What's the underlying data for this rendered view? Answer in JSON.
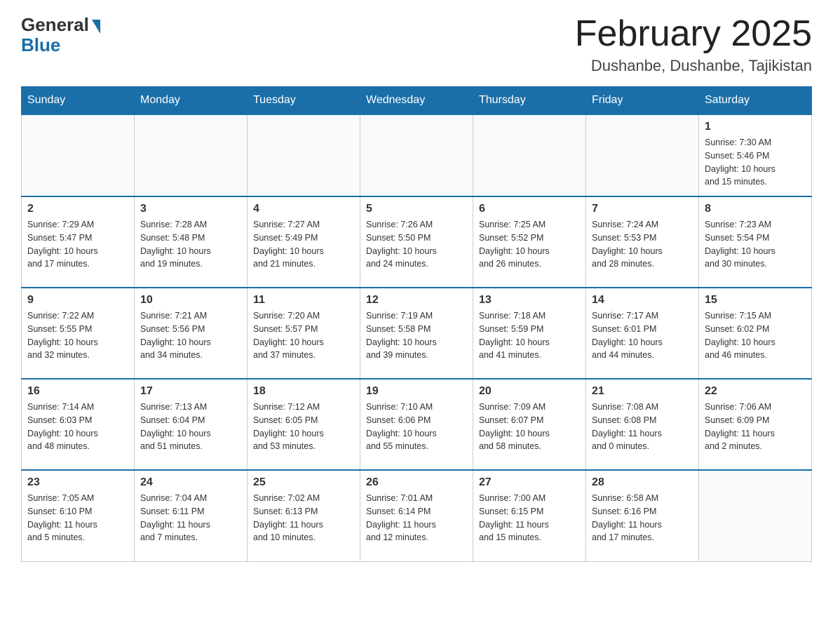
{
  "logo": {
    "general": "General",
    "blue": "Blue"
  },
  "title": "February 2025",
  "location": "Dushanbe, Dushanbe, Tajikistan",
  "days_of_week": [
    "Sunday",
    "Monday",
    "Tuesday",
    "Wednesday",
    "Thursday",
    "Friday",
    "Saturday"
  ],
  "weeks": [
    [
      {
        "day": "",
        "info": ""
      },
      {
        "day": "",
        "info": ""
      },
      {
        "day": "",
        "info": ""
      },
      {
        "day": "",
        "info": ""
      },
      {
        "day": "",
        "info": ""
      },
      {
        "day": "",
        "info": ""
      },
      {
        "day": "1",
        "info": "Sunrise: 7:30 AM\nSunset: 5:46 PM\nDaylight: 10 hours\nand 15 minutes."
      }
    ],
    [
      {
        "day": "2",
        "info": "Sunrise: 7:29 AM\nSunset: 5:47 PM\nDaylight: 10 hours\nand 17 minutes."
      },
      {
        "day": "3",
        "info": "Sunrise: 7:28 AM\nSunset: 5:48 PM\nDaylight: 10 hours\nand 19 minutes."
      },
      {
        "day": "4",
        "info": "Sunrise: 7:27 AM\nSunset: 5:49 PM\nDaylight: 10 hours\nand 21 minutes."
      },
      {
        "day": "5",
        "info": "Sunrise: 7:26 AM\nSunset: 5:50 PM\nDaylight: 10 hours\nand 24 minutes."
      },
      {
        "day": "6",
        "info": "Sunrise: 7:25 AM\nSunset: 5:52 PM\nDaylight: 10 hours\nand 26 minutes."
      },
      {
        "day": "7",
        "info": "Sunrise: 7:24 AM\nSunset: 5:53 PM\nDaylight: 10 hours\nand 28 minutes."
      },
      {
        "day": "8",
        "info": "Sunrise: 7:23 AM\nSunset: 5:54 PM\nDaylight: 10 hours\nand 30 minutes."
      }
    ],
    [
      {
        "day": "9",
        "info": "Sunrise: 7:22 AM\nSunset: 5:55 PM\nDaylight: 10 hours\nand 32 minutes."
      },
      {
        "day": "10",
        "info": "Sunrise: 7:21 AM\nSunset: 5:56 PM\nDaylight: 10 hours\nand 34 minutes."
      },
      {
        "day": "11",
        "info": "Sunrise: 7:20 AM\nSunset: 5:57 PM\nDaylight: 10 hours\nand 37 minutes."
      },
      {
        "day": "12",
        "info": "Sunrise: 7:19 AM\nSunset: 5:58 PM\nDaylight: 10 hours\nand 39 minutes."
      },
      {
        "day": "13",
        "info": "Sunrise: 7:18 AM\nSunset: 5:59 PM\nDaylight: 10 hours\nand 41 minutes."
      },
      {
        "day": "14",
        "info": "Sunrise: 7:17 AM\nSunset: 6:01 PM\nDaylight: 10 hours\nand 44 minutes."
      },
      {
        "day": "15",
        "info": "Sunrise: 7:15 AM\nSunset: 6:02 PM\nDaylight: 10 hours\nand 46 minutes."
      }
    ],
    [
      {
        "day": "16",
        "info": "Sunrise: 7:14 AM\nSunset: 6:03 PM\nDaylight: 10 hours\nand 48 minutes."
      },
      {
        "day": "17",
        "info": "Sunrise: 7:13 AM\nSunset: 6:04 PM\nDaylight: 10 hours\nand 51 minutes."
      },
      {
        "day": "18",
        "info": "Sunrise: 7:12 AM\nSunset: 6:05 PM\nDaylight: 10 hours\nand 53 minutes."
      },
      {
        "day": "19",
        "info": "Sunrise: 7:10 AM\nSunset: 6:06 PM\nDaylight: 10 hours\nand 55 minutes."
      },
      {
        "day": "20",
        "info": "Sunrise: 7:09 AM\nSunset: 6:07 PM\nDaylight: 10 hours\nand 58 minutes."
      },
      {
        "day": "21",
        "info": "Sunrise: 7:08 AM\nSunset: 6:08 PM\nDaylight: 11 hours\nand 0 minutes."
      },
      {
        "day": "22",
        "info": "Sunrise: 7:06 AM\nSunset: 6:09 PM\nDaylight: 11 hours\nand 2 minutes."
      }
    ],
    [
      {
        "day": "23",
        "info": "Sunrise: 7:05 AM\nSunset: 6:10 PM\nDaylight: 11 hours\nand 5 minutes."
      },
      {
        "day": "24",
        "info": "Sunrise: 7:04 AM\nSunset: 6:11 PM\nDaylight: 11 hours\nand 7 minutes."
      },
      {
        "day": "25",
        "info": "Sunrise: 7:02 AM\nSunset: 6:13 PM\nDaylight: 11 hours\nand 10 minutes."
      },
      {
        "day": "26",
        "info": "Sunrise: 7:01 AM\nSunset: 6:14 PM\nDaylight: 11 hours\nand 12 minutes."
      },
      {
        "day": "27",
        "info": "Sunrise: 7:00 AM\nSunset: 6:15 PM\nDaylight: 11 hours\nand 15 minutes."
      },
      {
        "day": "28",
        "info": "Sunrise: 6:58 AM\nSunset: 6:16 PM\nDaylight: 11 hours\nand 17 minutes."
      },
      {
        "day": "",
        "info": ""
      }
    ]
  ]
}
